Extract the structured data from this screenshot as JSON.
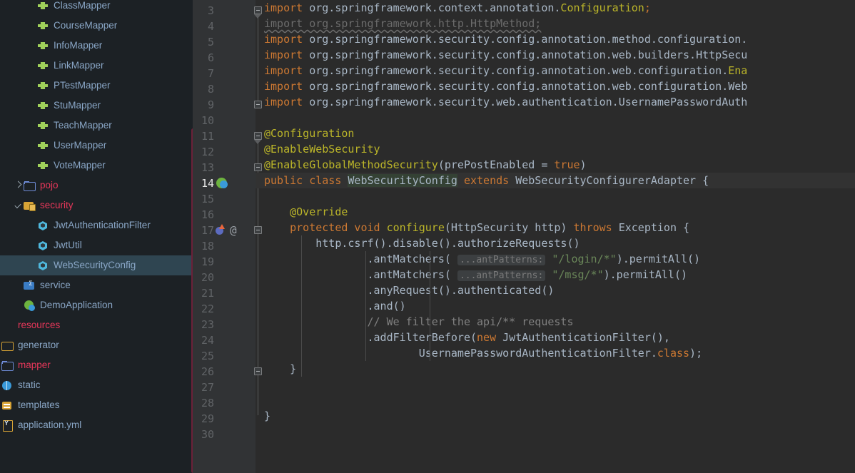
{
  "sidebar": {
    "scrollbar_color": "#6b2139",
    "selected_item": "WebSecurityConfig",
    "items": [
      {
        "label": "ClassMapper",
        "icon": "mapper-icon",
        "indent": 2,
        "arrow": "none",
        "color": "blue",
        "selected": false,
        "clipped_top": true
      },
      {
        "label": "CourseMapper",
        "icon": "mapper-icon",
        "indent": 2,
        "arrow": "none",
        "color": "blue",
        "selected": false
      },
      {
        "label": "InfoMapper",
        "icon": "mapper-icon",
        "indent": 2,
        "arrow": "none",
        "color": "blue",
        "selected": false
      },
      {
        "label": "LinkMapper",
        "icon": "mapper-icon",
        "indent": 2,
        "arrow": "none",
        "color": "blue",
        "selected": false
      },
      {
        "label": "PTestMapper",
        "icon": "mapper-icon",
        "indent": 2,
        "arrow": "none",
        "color": "blue",
        "selected": false
      },
      {
        "label": "StuMapper",
        "icon": "mapper-icon",
        "indent": 2,
        "arrow": "none",
        "color": "blue",
        "selected": false
      },
      {
        "label": "TeachMapper",
        "icon": "mapper-icon",
        "indent": 2,
        "arrow": "none",
        "color": "blue",
        "selected": false
      },
      {
        "label": "UserMapper",
        "icon": "mapper-icon",
        "indent": 2,
        "arrow": "none",
        "color": "blue",
        "selected": false
      },
      {
        "label": "VoteMapper",
        "icon": "mapper-icon",
        "indent": 2,
        "arrow": "none",
        "color": "blue",
        "selected": false
      },
      {
        "label": "pojo",
        "icon": "folder-icon",
        "indent": 1,
        "arrow": "right",
        "color": "crimson",
        "selected": false
      },
      {
        "label": "security",
        "icon": "folder-secured-icon",
        "indent": 1,
        "arrow": "down",
        "color": "crimson",
        "selected": false
      },
      {
        "label": "JwtAuthenticationFilter",
        "icon": "java-class-icon",
        "indent": 2,
        "arrow": "none",
        "color": "blue",
        "selected": false
      },
      {
        "label": "JwtUtil",
        "icon": "java-class-icon",
        "indent": 2,
        "arrow": "none",
        "color": "blue",
        "selected": false
      },
      {
        "label": "WebSecurityConfig",
        "icon": "java-class-icon",
        "indent": 2,
        "arrow": "none",
        "color": "blue",
        "selected": true
      },
      {
        "label": "service",
        "icon": "service-folder-icon",
        "indent": 1,
        "arrow": "none",
        "color": "blue",
        "selected": false
      },
      {
        "label": "DemoApplication",
        "icon": "spring-boot-icon",
        "indent": 1,
        "arrow": "none",
        "color": "blue",
        "selected": false
      },
      {
        "label": "resources",
        "icon": "none",
        "indent": 0,
        "arrow": "none",
        "color": "crimson",
        "selected": false,
        "clipped_left": true
      },
      {
        "label": "generator",
        "icon": "folder-yellow-icon",
        "indent": 0,
        "arrow": "none",
        "color": "blue",
        "selected": false,
        "clipped_left": true
      },
      {
        "label": "mapper",
        "icon": "folder-icon",
        "indent": 0,
        "arrow": "none",
        "color": "crimson",
        "selected": false,
        "clipped_left": true
      },
      {
        "label": "static",
        "icon": "globe-icon",
        "indent": 0,
        "arrow": "none",
        "color": "blue",
        "selected": false,
        "clipped_left": true
      },
      {
        "label": "templates",
        "icon": "templates-icon",
        "indent": 0,
        "arrow": "none",
        "color": "blue",
        "selected": false,
        "clipped_left": true
      },
      {
        "label": "application.yml",
        "icon": "yml-file-icon",
        "indent": 0,
        "arrow": "none",
        "color": "blue",
        "selected": false,
        "clipped_left": true
      }
    ]
  },
  "editor": {
    "file": "WebSecurityConfig",
    "language": "java",
    "first_visible_line": 3,
    "last_visible_line": 30,
    "current_line": 14,
    "caret_line": 14,
    "caret_column": 19,
    "background": "#2b2b2b",
    "gutter_background": "#313335",
    "gutter_icons": [
      {
        "line": 14,
        "icon": "spring-bean-icon"
      },
      {
        "line": 17,
        "icon": "overriding-method-icon"
      },
      {
        "line": 17,
        "icon": "annotation-at-icon",
        "glyph": "@"
      }
    ],
    "inlay_hints": [
      {
        "line": 19,
        "text": "...antPatterns:"
      },
      {
        "line": 20,
        "text": "...antPatterns:"
      }
    ],
    "lines": [
      {
        "n": 3,
        "text": "import org.springframework.context.annotation.Configuration;"
      },
      {
        "n": 4,
        "text": "import org.springframework.http.HttpMethod;",
        "state": "unused-import"
      },
      {
        "n": 5,
        "text": "import org.springframework.security.config.annotation.method.configuration."
      },
      {
        "n": 6,
        "text": "import org.springframework.security.config.annotation.web.builders.HttpSecu"
      },
      {
        "n": 7,
        "text": "import org.springframework.security.config.annotation.web.configuration.Ena"
      },
      {
        "n": 8,
        "text": "import org.springframework.security.config.annotation.web.configuration.Web"
      },
      {
        "n": 9,
        "text": "import org.springframework.security.web.authentication.UsernamePasswordAuth"
      },
      {
        "n": 10,
        "text": ""
      },
      {
        "n": 11,
        "text": "@Configuration"
      },
      {
        "n": 12,
        "text": "@EnableWebSecurity"
      },
      {
        "n": 13,
        "text": "@EnableGlobalMethodSecurity(prePostEnabled = true)"
      },
      {
        "n": 14,
        "text": "public class WebSecurityConfig extends WebSecurityConfigurerAdapter {"
      },
      {
        "n": 15,
        "text": ""
      },
      {
        "n": 16,
        "text": "    @Override"
      },
      {
        "n": 17,
        "text": "    protected void configure(HttpSecurity http) throws Exception {"
      },
      {
        "n": 18,
        "text": "        http.csrf().disable().authorizeRequests()"
      },
      {
        "n": 19,
        "text": "                .antMatchers( \"/login/*\").permitAll()"
      },
      {
        "n": 20,
        "text": "                .antMatchers( \"/msg/*\").permitAll()"
      },
      {
        "n": 21,
        "text": "                .anyRequest().authenticated()"
      },
      {
        "n": 22,
        "text": "                .and()"
      },
      {
        "n": 23,
        "text": "                // We filter the api/** requests"
      },
      {
        "n": 24,
        "text": "                .addFilterBefore(new JwtAuthenticationFilter(),"
      },
      {
        "n": 25,
        "text": "                        UsernamePasswordAuthenticationFilter.class);"
      },
      {
        "n": 26,
        "text": "    }"
      },
      {
        "n": 27,
        "text": ""
      },
      {
        "n": 28,
        "text": ""
      },
      {
        "n": 29,
        "text": "}"
      },
      {
        "n": 30,
        "text": ""
      }
    ],
    "tokens": {
      "keyword_import": "import",
      "keyword_public": "public",
      "keyword_class": "class",
      "keyword_extends": "extends",
      "keyword_protected": "protected",
      "keyword_void": "void",
      "keyword_throws": "throws",
      "keyword_new": "new",
      "keyword_true": "true",
      "keyword_class_literal": "class",
      "class_Configuration": "Configuration",
      "class_Ena": "Ena",
      "ann_Configuration": "@Configuration",
      "ann_EnableWebSecurity": "@EnableWebSecurity",
      "ann_EnableGlobalMethodSecurity": "@EnableGlobalMethodSecurity",
      "ann_Override": "@Override",
      "str_login": "\"/login/*\"",
      "str_msg": "\"/msg/*\"",
      "comment_filter": "// We filter the api/** requests",
      "method_configure": "configure"
    },
    "colors": {
      "keyword": "#cc7832",
      "annotation": "#bbb529",
      "string": "#6a8759",
      "comment": "#808080",
      "identifier": "#a9b7c6",
      "line_number": "#606366",
      "current_line_number": "#e6e6e6",
      "unused": "#6b6b6b",
      "caret_highlight": "#344134"
    }
  }
}
